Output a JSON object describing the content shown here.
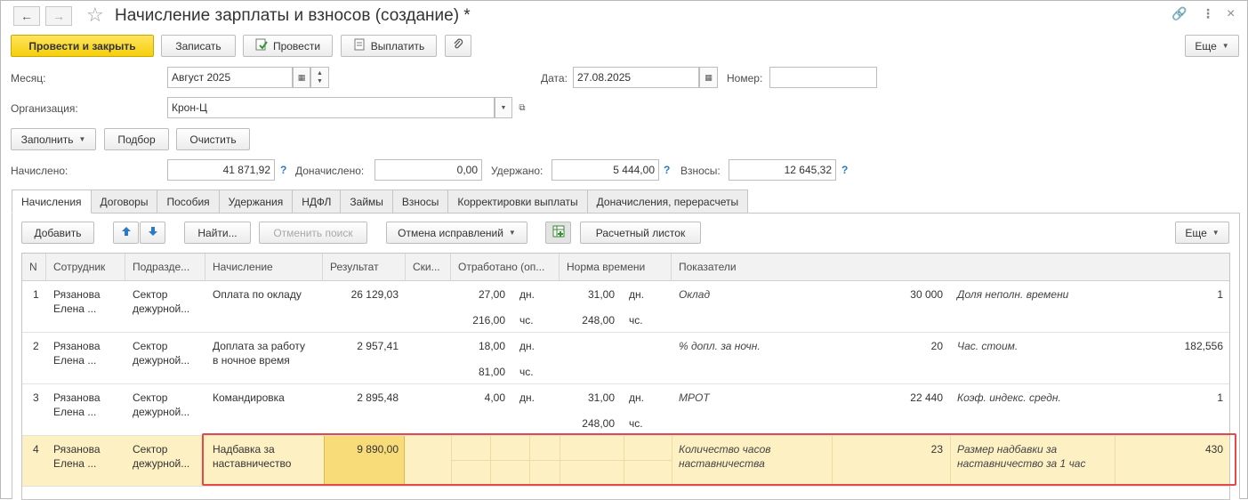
{
  "window": {
    "title": "Начисление зарплаты и взносов (создание) *"
  },
  "toolbar": {
    "post_close": "Провести и закрыть",
    "save": "Записать",
    "post": "Провести",
    "pay": "Выплатить",
    "more": "Еще"
  },
  "form": {
    "month_label": "Месяц:",
    "month_value": "Август 2025",
    "date_label": "Дата:",
    "date_value": "27.08.2025",
    "number_label": "Номер:",
    "number_value": "",
    "org_label": "Организация:",
    "org_value": "Крон-Ц"
  },
  "actions": {
    "fill": "Заполнить",
    "pick": "Подбор",
    "clear": "Очистить"
  },
  "totals": {
    "accrued_label": "Начислено:",
    "accrued_value": "41 871,92",
    "extra_label": "Доначислено:",
    "extra_value": "0,00",
    "withheld_label": "Удержано:",
    "withheld_value": "5 444,00",
    "contrib_label": "Взносы:",
    "contrib_value": "12 645,32",
    "help": "?"
  },
  "tabs": [
    "Начисления",
    "Договоры",
    "Пособия",
    "Удержания",
    "НДФЛ",
    "Займы",
    "Взносы",
    "Корректировки выплаты",
    "Доначисления, перерасчеты"
  ],
  "table_toolbar": {
    "add": "Добавить",
    "find": "Найти...",
    "cancel_search": "Отменить поиск",
    "undo_corrections": "Отмена исправлений",
    "payslip": "Расчетный листок",
    "more": "Еще"
  },
  "table": {
    "columns": [
      "N",
      "Сотрудник",
      "Подразде...",
      "Начисление",
      "Результат",
      "Ски...",
      "Отработано (оп...",
      "Норма времени",
      "Показатели"
    ],
    "rows": [
      {
        "n": "1",
        "emp1": "Рязанова",
        "emp2": "Елена ...",
        "dep1": "Сектор",
        "dep2": "дежурной...",
        "acc1": "Оплата по окладу",
        "acc2": "",
        "result": "26 129,03",
        "worked1": "27,00",
        "unit1": "дн.",
        "worked2": "216,00",
        "unit2": "чс.",
        "norm1": "31,00",
        "nunit1": "дн.",
        "norm2": "248,00",
        "nunit2": "чс.",
        "ind1_name": "Оклад",
        "ind1_val": "30 000",
        "ind2_name": "Доля неполн. времени",
        "ind2_val": "1"
      },
      {
        "n": "2",
        "emp1": "Рязанова",
        "emp2": "Елена ...",
        "dep1": "Сектор",
        "dep2": "дежурной...",
        "acc1": "Доплата за работу",
        "acc2": "в ночное время",
        "result": "2 957,41",
        "worked1": "18,00",
        "unit1": "дн.",
        "worked2": "81,00",
        "unit2": "чс.",
        "norm1": "",
        "nunit1": "",
        "norm2": "",
        "nunit2": "",
        "ind1_name": "% допл. за ночн.",
        "ind1_val": "20",
        "ind2_name": "Час. стоим.",
        "ind2_val": "182,556"
      },
      {
        "n": "3",
        "emp1": "Рязанова",
        "emp2": "Елена ...",
        "dep1": "Сектор",
        "dep2": "дежурной...",
        "acc1": "Командировка",
        "acc2": "",
        "result": "2 895,48",
        "worked1": "4,00",
        "unit1": "дн.",
        "worked2": "",
        "unit2": "",
        "norm1": "31,00",
        "nunit1": "дн.",
        "norm2": "248,00",
        "nunit2": "чс.",
        "ind1_name": "МРОТ",
        "ind1_val": "22 440",
        "ind2_name": "Коэф. индекс. средн.",
        "ind2_val": "1"
      },
      {
        "n": "4",
        "emp1": "Рязанова",
        "emp2": "Елена ...",
        "dep1": "Сектор",
        "dep2": "дежурной...",
        "acc1": "Надбавка за",
        "acc2": "наставничество",
        "result": "9 890,00",
        "worked1": "",
        "unit1": "",
        "worked2": "",
        "unit2": "",
        "norm1": "",
        "nunit1": "",
        "norm2": "",
        "nunit2": "",
        "ind1_name": "Количество часов",
        "ind1_name2": "наставничества",
        "ind1_val": "23",
        "ind2_name": "Размер надбавки за",
        "ind2_name2": "наставничество за 1 час",
        "ind2_val": "430"
      }
    ]
  },
  "colors": {
    "primary_button": "#f5cf0c",
    "selected_row": "#fdf1c4",
    "selected_cell": "#f9dc7a",
    "highlight_box": "#e24a4a",
    "help": "#2a7ac6"
  }
}
